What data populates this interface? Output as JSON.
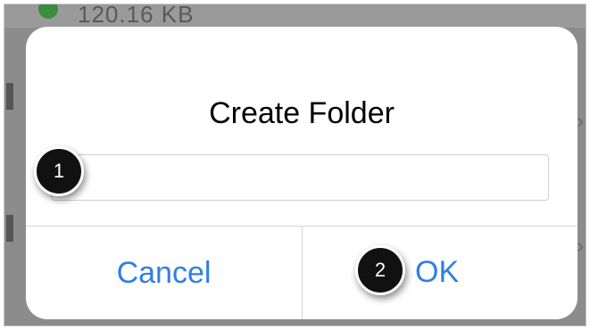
{
  "background": {
    "file_size_text": "120.16 KB"
  },
  "dialog": {
    "title": "Create Folder",
    "folder_name_input": {
      "value": "",
      "placeholder": ""
    },
    "cancel_label": "Cancel",
    "ok_label": "OK"
  },
  "callouts": {
    "input_step": "1",
    "ok_step": "2"
  },
  "colors": {
    "button_text": "#2f7fe3",
    "callout_fill": "#111111",
    "overlay": "#8c8c8c"
  }
}
